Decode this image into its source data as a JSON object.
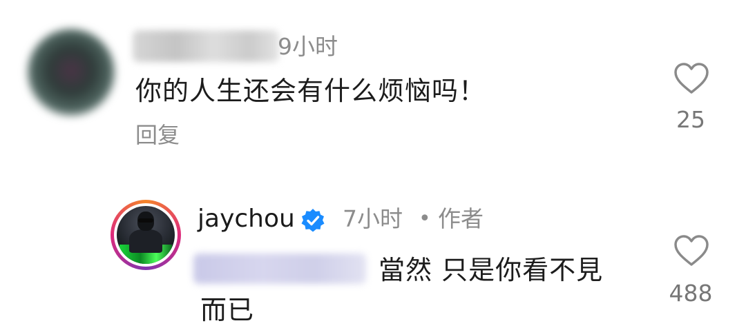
{
  "comments": [
    {
      "username": "",
      "time": "9小时",
      "text": "你的人生还会有什么烦恼吗！",
      "reply_label": "回复",
      "likes": "25"
    },
    {
      "username": "jaychou",
      "verified": true,
      "time": "7小时",
      "separator": "•",
      "author_badge": "作者",
      "text_line1": "當然 只是你看不見",
      "text_line2": "而已",
      "likes": "488"
    }
  ],
  "icons": {
    "like": "heart-outline-icon",
    "verified": "verified-badge-icon"
  },
  "colors": {
    "verified_badge": "#1a8cff",
    "secondary_text": "#8c8c8c"
  }
}
